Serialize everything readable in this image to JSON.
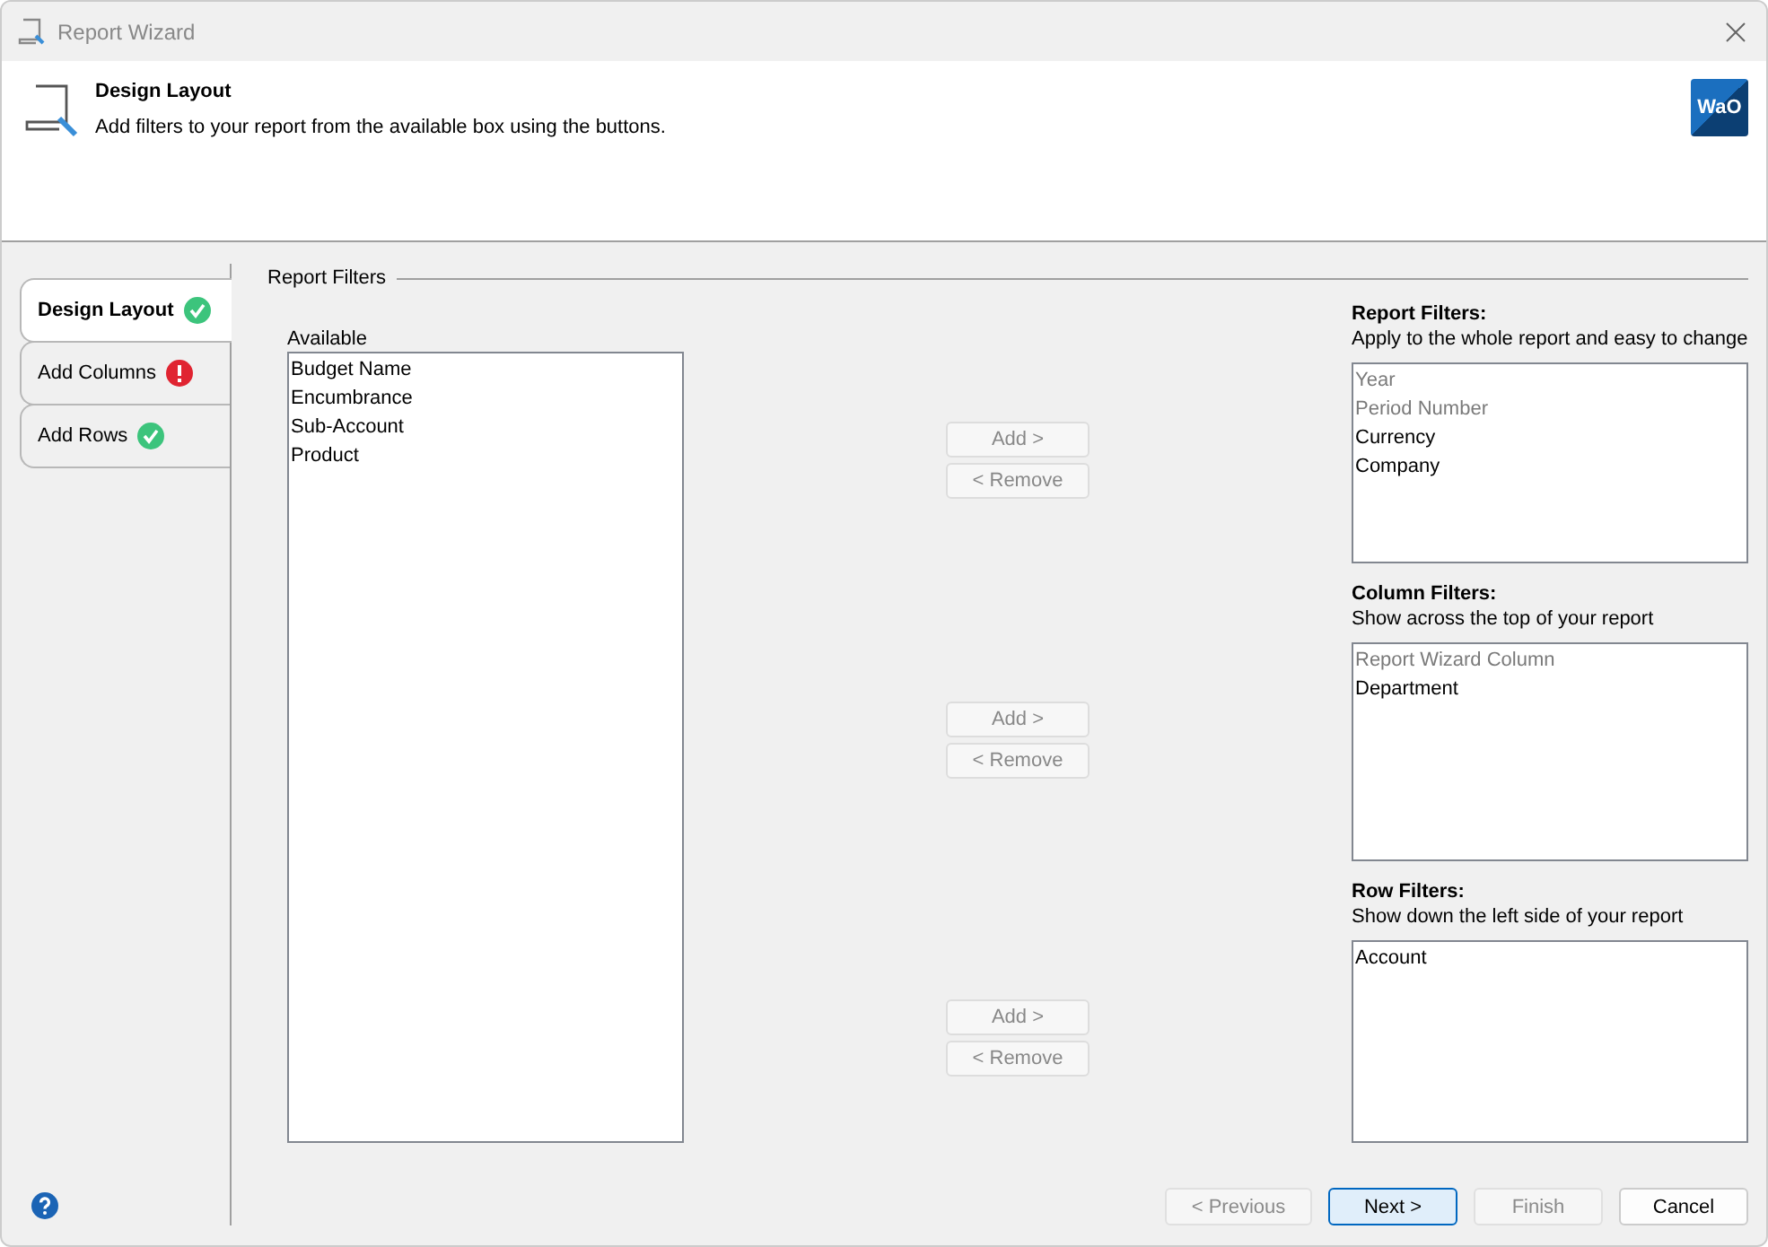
{
  "window": {
    "title": "Report Wizard"
  },
  "header": {
    "title": "Design Layout",
    "description": "Add filters to your report from the available box using the buttons.",
    "logo": "WaO"
  },
  "steps": [
    {
      "label": "Design Layout",
      "selected": true,
      "valid": true
    },
    {
      "label": "Add Columns",
      "selected": false,
      "valid": false
    },
    {
      "label": "Add Rows",
      "selected": false,
      "valid": true
    }
  ],
  "group_title": "Report Filters",
  "available": {
    "label": "Available",
    "items": [
      "Budget Name",
      "Encumbrance",
      "Sub-Account",
      "Product"
    ]
  },
  "sections": [
    {
      "title": "Report Filters:",
      "description": "Apply to the whole report and easy to change",
      "add_button": {
        "label": "Add >",
        "disabled": true
      },
      "remove_button": {
        "label": "< Remove",
        "disabled": true
      },
      "items": [
        {
          "label": "Year",
          "locked": true
        },
        {
          "label": "Period Number",
          "locked": true
        },
        {
          "label": "Currency",
          "locked": false
        },
        {
          "label": "Company",
          "locked": false
        }
      ]
    },
    {
      "title": "Column Filters:",
      "description": "Show across the top of your report",
      "add_button": {
        "label": "Add >",
        "disabled": true
      },
      "remove_button": {
        "label": "< Remove",
        "disabled": true
      },
      "items": [
        {
          "label": "Report Wizard Column",
          "locked": true
        },
        {
          "label": "Department",
          "locked": false
        }
      ]
    },
    {
      "title": "Row Filters:",
      "description": "Show down the left side of your report",
      "add_button": {
        "label": "Add >",
        "disabled": true
      },
      "remove_button": {
        "label": "< Remove",
        "disabled": true
      },
      "items": [
        {
          "label": "Account",
          "locked": false
        }
      ]
    }
  ],
  "footer_buttons": [
    {
      "label": "< Previous",
      "disabled": true,
      "default": false
    },
    {
      "label": "Next >",
      "disabled": false,
      "default": true
    },
    {
      "label": "Finish",
      "disabled": true,
      "default": false
    },
    {
      "label": "Cancel",
      "disabled": false,
      "default": false
    }
  ]
}
